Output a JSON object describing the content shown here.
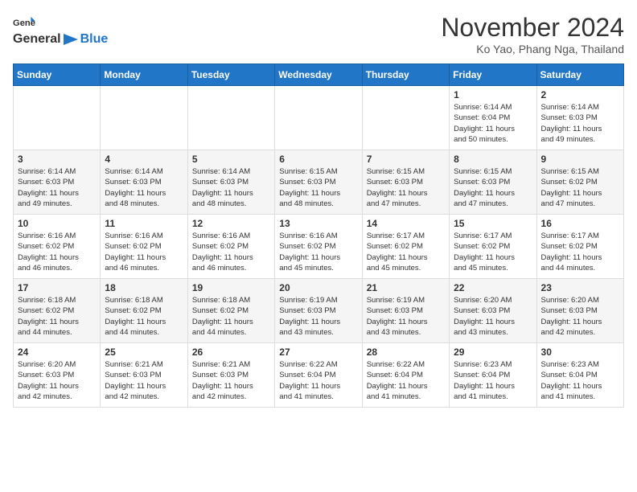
{
  "header": {
    "logo_general": "General",
    "logo_blue": "Blue",
    "month_year": "November 2024",
    "location": "Ko Yao, Phang Nga, Thailand"
  },
  "weekdays": [
    "Sunday",
    "Monday",
    "Tuesday",
    "Wednesday",
    "Thursday",
    "Friday",
    "Saturday"
  ],
  "weeks": [
    [
      {
        "day": "",
        "info": ""
      },
      {
        "day": "",
        "info": ""
      },
      {
        "day": "",
        "info": ""
      },
      {
        "day": "",
        "info": ""
      },
      {
        "day": "",
        "info": ""
      },
      {
        "day": "1",
        "info": "Sunrise: 6:14 AM\nSunset: 6:04 PM\nDaylight: 11 hours\nand 50 minutes."
      },
      {
        "day": "2",
        "info": "Sunrise: 6:14 AM\nSunset: 6:03 PM\nDaylight: 11 hours\nand 49 minutes."
      }
    ],
    [
      {
        "day": "3",
        "info": "Sunrise: 6:14 AM\nSunset: 6:03 PM\nDaylight: 11 hours\nand 49 minutes."
      },
      {
        "day": "4",
        "info": "Sunrise: 6:14 AM\nSunset: 6:03 PM\nDaylight: 11 hours\nand 48 minutes."
      },
      {
        "day": "5",
        "info": "Sunrise: 6:14 AM\nSunset: 6:03 PM\nDaylight: 11 hours\nand 48 minutes."
      },
      {
        "day": "6",
        "info": "Sunrise: 6:15 AM\nSunset: 6:03 PM\nDaylight: 11 hours\nand 48 minutes."
      },
      {
        "day": "7",
        "info": "Sunrise: 6:15 AM\nSunset: 6:03 PM\nDaylight: 11 hours\nand 47 minutes."
      },
      {
        "day": "8",
        "info": "Sunrise: 6:15 AM\nSunset: 6:03 PM\nDaylight: 11 hours\nand 47 minutes."
      },
      {
        "day": "9",
        "info": "Sunrise: 6:15 AM\nSunset: 6:02 PM\nDaylight: 11 hours\nand 47 minutes."
      }
    ],
    [
      {
        "day": "10",
        "info": "Sunrise: 6:16 AM\nSunset: 6:02 PM\nDaylight: 11 hours\nand 46 minutes."
      },
      {
        "day": "11",
        "info": "Sunrise: 6:16 AM\nSunset: 6:02 PM\nDaylight: 11 hours\nand 46 minutes."
      },
      {
        "day": "12",
        "info": "Sunrise: 6:16 AM\nSunset: 6:02 PM\nDaylight: 11 hours\nand 46 minutes."
      },
      {
        "day": "13",
        "info": "Sunrise: 6:16 AM\nSunset: 6:02 PM\nDaylight: 11 hours\nand 45 minutes."
      },
      {
        "day": "14",
        "info": "Sunrise: 6:17 AM\nSunset: 6:02 PM\nDaylight: 11 hours\nand 45 minutes."
      },
      {
        "day": "15",
        "info": "Sunrise: 6:17 AM\nSunset: 6:02 PM\nDaylight: 11 hours\nand 45 minutes."
      },
      {
        "day": "16",
        "info": "Sunrise: 6:17 AM\nSunset: 6:02 PM\nDaylight: 11 hours\nand 44 minutes."
      }
    ],
    [
      {
        "day": "17",
        "info": "Sunrise: 6:18 AM\nSunset: 6:02 PM\nDaylight: 11 hours\nand 44 minutes."
      },
      {
        "day": "18",
        "info": "Sunrise: 6:18 AM\nSunset: 6:02 PM\nDaylight: 11 hours\nand 44 minutes."
      },
      {
        "day": "19",
        "info": "Sunrise: 6:18 AM\nSunset: 6:02 PM\nDaylight: 11 hours\nand 44 minutes."
      },
      {
        "day": "20",
        "info": "Sunrise: 6:19 AM\nSunset: 6:03 PM\nDaylight: 11 hours\nand 43 minutes."
      },
      {
        "day": "21",
        "info": "Sunrise: 6:19 AM\nSunset: 6:03 PM\nDaylight: 11 hours\nand 43 minutes."
      },
      {
        "day": "22",
        "info": "Sunrise: 6:20 AM\nSunset: 6:03 PM\nDaylight: 11 hours\nand 43 minutes."
      },
      {
        "day": "23",
        "info": "Sunrise: 6:20 AM\nSunset: 6:03 PM\nDaylight: 11 hours\nand 42 minutes."
      }
    ],
    [
      {
        "day": "24",
        "info": "Sunrise: 6:20 AM\nSunset: 6:03 PM\nDaylight: 11 hours\nand 42 minutes."
      },
      {
        "day": "25",
        "info": "Sunrise: 6:21 AM\nSunset: 6:03 PM\nDaylight: 11 hours\nand 42 minutes."
      },
      {
        "day": "26",
        "info": "Sunrise: 6:21 AM\nSunset: 6:03 PM\nDaylight: 11 hours\nand 42 minutes."
      },
      {
        "day": "27",
        "info": "Sunrise: 6:22 AM\nSunset: 6:04 PM\nDaylight: 11 hours\nand 41 minutes."
      },
      {
        "day": "28",
        "info": "Sunrise: 6:22 AM\nSunset: 6:04 PM\nDaylight: 11 hours\nand 41 minutes."
      },
      {
        "day": "29",
        "info": "Sunrise: 6:23 AM\nSunset: 6:04 PM\nDaylight: 11 hours\nand 41 minutes."
      },
      {
        "day": "30",
        "info": "Sunrise: 6:23 AM\nSunset: 6:04 PM\nDaylight: 11 hours\nand 41 minutes."
      }
    ]
  ]
}
